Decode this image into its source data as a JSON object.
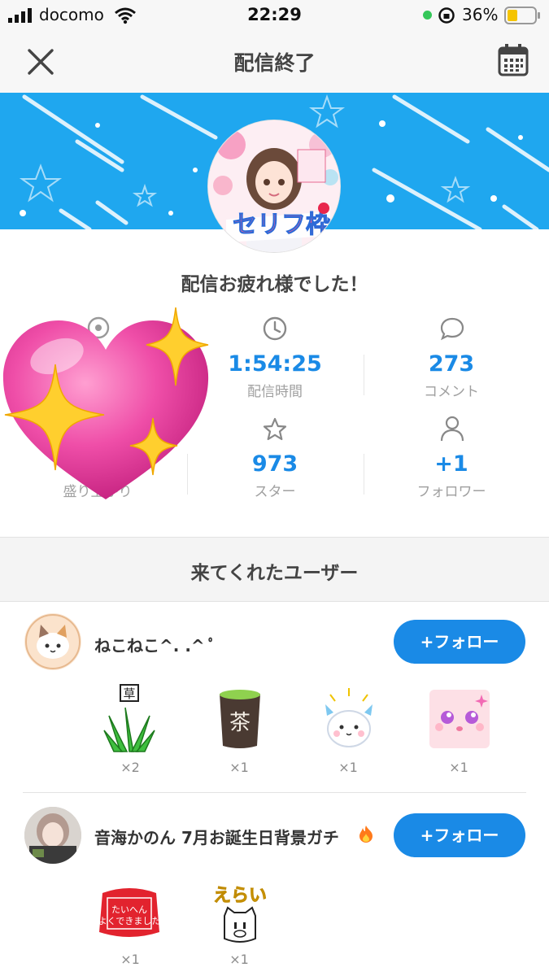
{
  "status_bar": {
    "carrier": "docomo",
    "time": "22:29",
    "battery": "36%"
  },
  "nav": {
    "title": "配信終了",
    "close_icon": "close-icon",
    "calendar_icon": "calendar-icon"
  },
  "banner": {
    "accent": "#1fa7ef"
  },
  "subtitle": "配信お疲れ様でした！",
  "stats": {
    "duration": {
      "value": "1:54:25",
      "label": "配信時間"
    },
    "comments": {
      "value": "273",
      "label": "コメント"
    },
    "stars": {
      "value": "973",
      "label": "スター"
    },
    "followers": {
      "value": "+1",
      "label": "フォロワー"
    },
    "hype_label": "盛り上がり"
  },
  "section_title": "来てくれたユーザー",
  "users": [
    {
      "name": "ねこねこ^. .^ ﾟ",
      "follow_label": "+フォロー",
      "gifts": [
        {
          "icon": "grass-icon",
          "count": "×2"
        },
        {
          "icon": "tea-icon",
          "count": "×1"
        },
        {
          "icon": "cute-creature-icon",
          "count": "×1"
        },
        {
          "icon": "sparkle-face-icon",
          "count": "×1"
        }
      ]
    },
    {
      "name": "音海かのん 7月お誕生日背景ガチ",
      "follow_label": "+フォロー",
      "gifts": [
        {
          "icon": "stamp-icon",
          "count": "×1"
        },
        {
          "icon": "erai-icon",
          "count": "×1"
        }
      ]
    }
  ],
  "colors": {
    "primary": "#1a8ae6",
    "heart": "#e83fa0",
    "sparkle": "#ffcf2e"
  }
}
